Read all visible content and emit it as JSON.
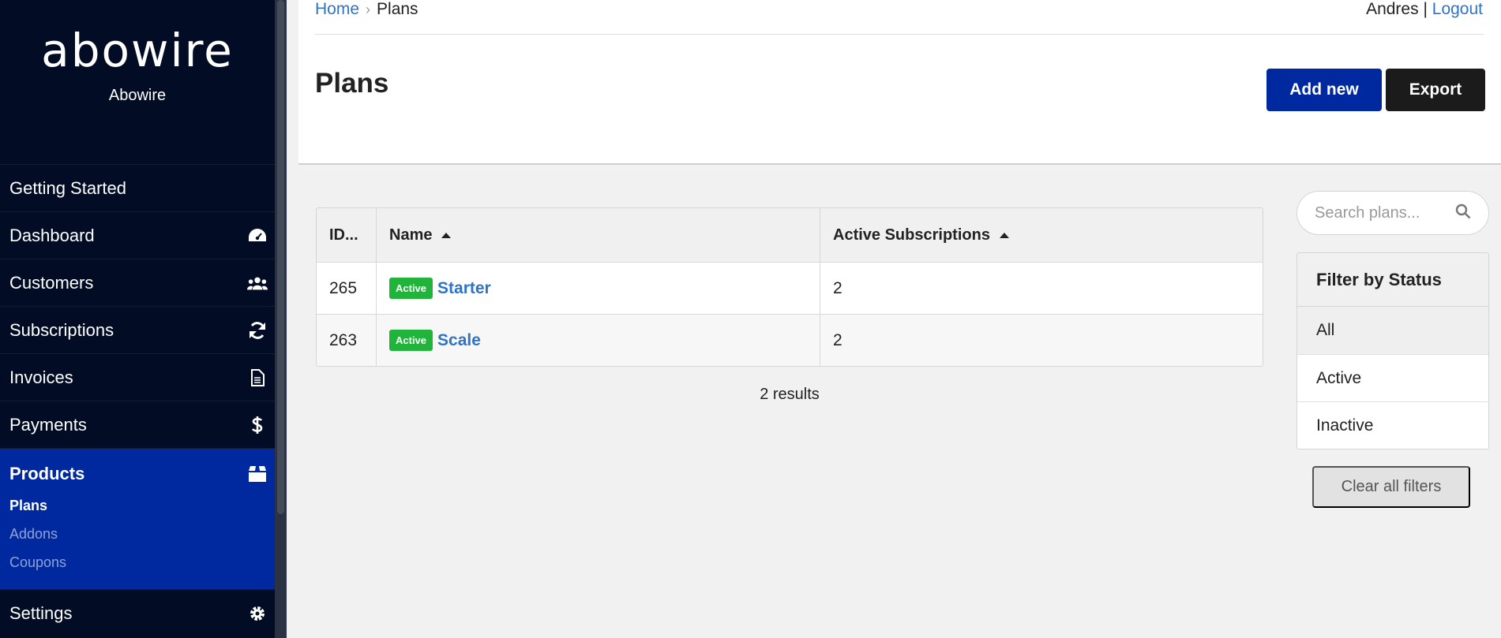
{
  "brand": {
    "logo": "abowire",
    "name": "Abowire"
  },
  "sidebar": {
    "items": [
      {
        "label": "Getting Started"
      },
      {
        "label": "Dashboard",
        "icon": "dashboard-icon"
      },
      {
        "label": "Customers",
        "icon": "users-icon"
      },
      {
        "label": "Subscriptions",
        "icon": "sync-icon"
      },
      {
        "label": "Invoices",
        "icon": "document-icon"
      },
      {
        "label": "Payments",
        "icon": "dollar-icon"
      },
      {
        "label": "Products",
        "icon": "box-icon",
        "active": true,
        "children": [
          {
            "label": "Plans",
            "current": true
          },
          {
            "label": "Addons"
          },
          {
            "label": "Coupons"
          }
        ]
      },
      {
        "label": "Settings",
        "icon": "gear-icon"
      }
    ]
  },
  "header": {
    "breadcrumb": [
      "Home",
      "Plans"
    ],
    "user": "Andres",
    "separator": "|",
    "logout": "Logout",
    "title": "Plans",
    "add_label": "Add new",
    "export_label": "Export"
  },
  "table": {
    "columns": [
      "ID...",
      "Name",
      "Active Subscriptions"
    ],
    "rows": [
      {
        "id": "265",
        "status": "Active",
        "name": "Starter",
        "active_subscriptions": "2"
      },
      {
        "id": "263",
        "status": "Active",
        "name": "Scale",
        "active_subscriptions": "2"
      }
    ],
    "results": "2 results"
  },
  "filters": {
    "search_placeholder": "Search plans...",
    "title": "Filter by Status",
    "options": [
      "All",
      "Active",
      "Inactive"
    ],
    "selected": "All",
    "clear_label": "Clear all filters"
  },
  "colors": {
    "sidebar_bg": "#020d25",
    "active_nav": "#0029a0",
    "badge": "#20b53a",
    "link": "#2f73c7"
  }
}
